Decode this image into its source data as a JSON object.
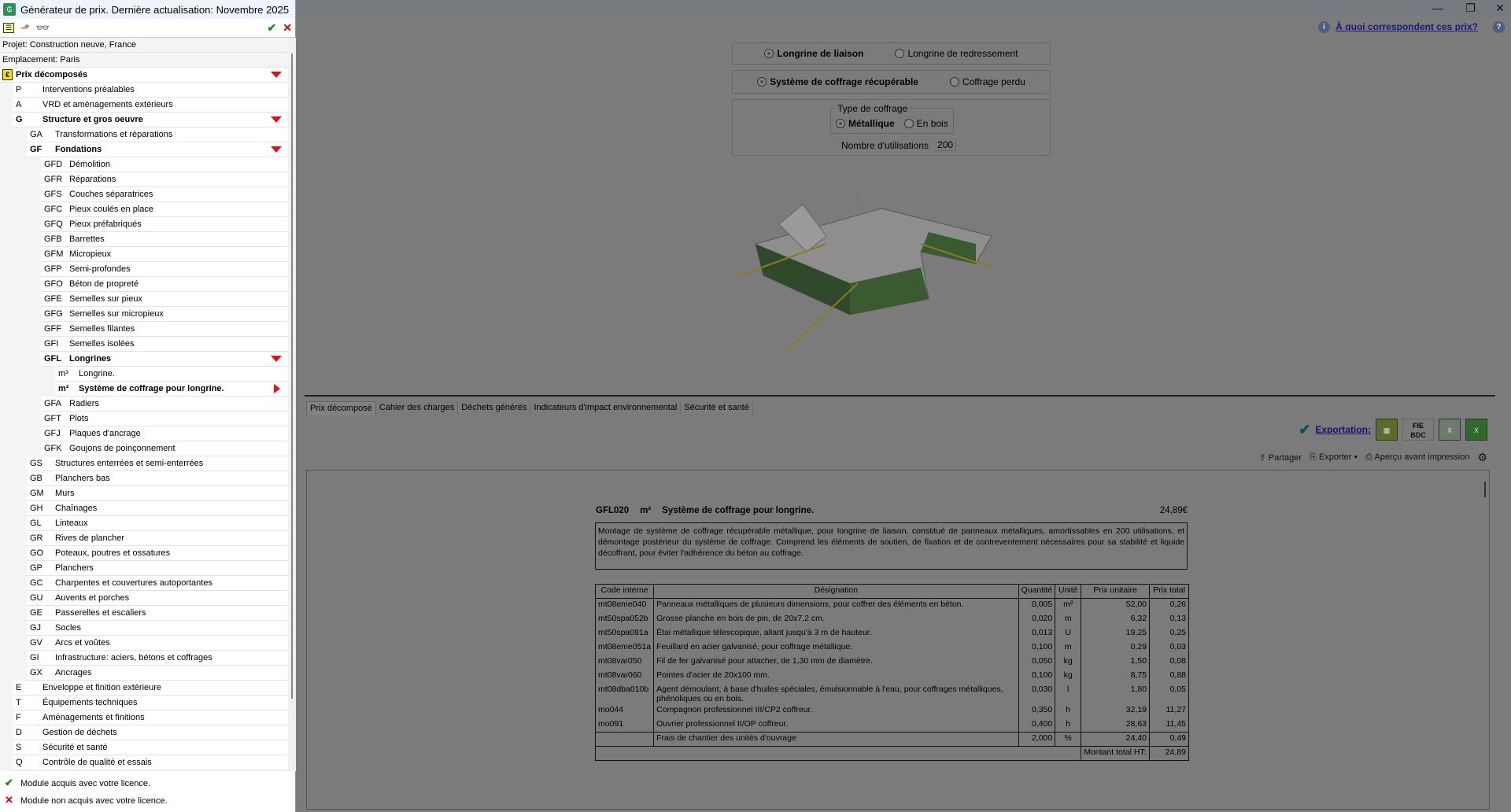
{
  "window": {
    "title": "Générateur de prix. Dernière actualisation: Novembre 2025"
  },
  "left": {
    "project": "Projet: Construction neuve, France",
    "location": "Emplacement: Paris",
    "tree": [
      {
        "code": "",
        "label": "Prix décomposés",
        "level": 0,
        "bold": true,
        "marker": "down"
      },
      {
        "code": "P",
        "label": "Interventions préalables",
        "level": 1
      },
      {
        "code": "A",
        "label": "VRD et aménagements extérieurs",
        "level": 1
      },
      {
        "code": "G",
        "label": "Structure et gros oeuvre",
        "level": 1,
        "bold": true,
        "marker": "down"
      },
      {
        "code": "GA",
        "label": "Transformations et réparations",
        "level": 2
      },
      {
        "code": "GF",
        "label": "Fondations",
        "level": 2,
        "bold": true,
        "marker": "down"
      },
      {
        "code": "GFD",
        "label": "Démolition",
        "level": 3
      },
      {
        "code": "GFR",
        "label": "Réparations",
        "level": 3
      },
      {
        "code": "GFS",
        "label": "Couches séparatrices",
        "level": 3
      },
      {
        "code": "GFC",
        "label": "Pieux coulés en place",
        "level": 3
      },
      {
        "code": "GFQ",
        "label": "Pieux préfabriqués",
        "level": 3
      },
      {
        "code": "GFB",
        "label": "Barrettes",
        "level": 3
      },
      {
        "code": "GFM",
        "label": "Micropieux",
        "level": 3
      },
      {
        "code": "GFP",
        "label": "Semi-profondes",
        "level": 3
      },
      {
        "code": "GFO",
        "label": "Béton de propreté",
        "level": 3
      },
      {
        "code": "GFE",
        "label": "Semelles sur pieux",
        "level": 3
      },
      {
        "code": "GFG",
        "label": "Semelles sur micropieux",
        "level": 3
      },
      {
        "code": "GFF",
        "label": "Semelles filantes",
        "level": 3
      },
      {
        "code": "GFI",
        "label": "Semelles isolées",
        "level": 3
      },
      {
        "code": "GFL",
        "label": "Longrines",
        "level": 3,
        "bold": true,
        "marker": "down"
      },
      {
        "code": "m³",
        "label": "Longrine.",
        "level": 4
      },
      {
        "code": "m²",
        "label": "Système de coffrage pour longrine.",
        "level": 4,
        "bold": true,
        "marker": "right"
      },
      {
        "code": "GFA",
        "label": "Radiers",
        "level": 3
      },
      {
        "code": "GFT",
        "label": "Plots",
        "level": 3
      },
      {
        "code": "GFJ",
        "label": "Plaques d'ancrage",
        "level": 3
      },
      {
        "code": "GFK",
        "label": "Goujons de poinçonnement",
        "level": 3
      },
      {
        "code": "GS",
        "label": "Structures enterrées et semi-enterrées",
        "level": 2
      },
      {
        "code": "GB",
        "label": "Planchers bas",
        "level": 2
      },
      {
        "code": "GM",
        "label": "Murs",
        "level": 2
      },
      {
        "code": "GH",
        "label": "Chaînages",
        "level": 2
      },
      {
        "code": "GL",
        "label": "Linteaux",
        "level": 2
      },
      {
        "code": "GR",
        "label": "Rives de plancher",
        "level": 2
      },
      {
        "code": "GO",
        "label": "Poteaux, poutres et ossatures",
        "level": 2
      },
      {
        "code": "GP",
        "label": "Planchers",
        "level": 2
      },
      {
        "code": "GC",
        "label": "Charpentes et couvertures autoportantes",
        "level": 2
      },
      {
        "code": "GU",
        "label": "Auvents et porches",
        "level": 2
      },
      {
        "code": "GE",
        "label": "Passerelles et escaliers",
        "level": 2
      },
      {
        "code": "GJ",
        "label": "Socles",
        "level": 2
      },
      {
        "code": "GV",
        "label": "Arcs et voûtes",
        "level": 2
      },
      {
        "code": "GI",
        "label": "Infrastructure: aciers, bétons et coffrages",
        "level": 2
      },
      {
        "code": "GX",
        "label": "Ancrages",
        "level": 2
      },
      {
        "code": "E",
        "label": "Enveloppe et finition extérieure",
        "level": 1
      },
      {
        "code": "T",
        "label": "Équipements techniques",
        "level": 1
      },
      {
        "code": "F",
        "label": "Aménagements et finitions",
        "level": 1
      },
      {
        "code": "D",
        "label": "Gestion de déchets",
        "level": 1
      },
      {
        "code": "S",
        "label": "Sécurité et santé",
        "level": 1
      },
      {
        "code": "Q",
        "label": "Contrôle de qualité et essais",
        "level": 1
      }
    ],
    "legend": {
      "acquired": "Module acquis avec votre licence.",
      "not_acquired": "Module non acquis avec votre licence."
    }
  },
  "right": {
    "help_link": "À quoi correspondent ces prix?",
    "options": {
      "type1": "Longrine de liaison",
      "type2": "Longrine de redressement",
      "sys1": "Système de coffrage récupérable",
      "sys2": "Coffrage perdu",
      "group_label": "Type de coffrage",
      "mat1": "Métallique",
      "mat2": "En bois",
      "uses_label": "Nombre d'utilisations",
      "uses_value": "200"
    },
    "tabs": [
      "Prix décomposé",
      "Cahier des charges",
      "Déchets générés",
      "Indicateurs d'impact environnemental",
      "Sécurité et santé"
    ],
    "export_label": "Exportation:",
    "export_icons": [
      "FIE",
      "BDC"
    ],
    "actions": {
      "share": "Partager",
      "export": "Exporter",
      "preview": "Aperçu avant impression"
    },
    "doc": {
      "code": "GFL020",
      "unit": "m²",
      "title": "Système de coffrage pour longrine.",
      "price": "24,89€",
      "description": "Montage de système de coffrage récupérable métallique, pour longrine de liaison, constitué de panneaux métalliques, amortissables en 200 utilisations, et démontage postérieur du système de coffrage. Comprend les éléments de soutien, de fixation et de contreventement nécessaires pour sa stabilité et liquide décoffrant, pour éviter l'adhérence du béton au coffrage.",
      "headers": [
        "Code interne",
        "Désignation",
        "Quantité",
        "Unité",
        "Prix unitaire",
        "Prix total"
      ],
      "rows": [
        [
          "mt08eme040",
          "Panneaux métalliques de plusieurs dimensions, pour coffrer des éléments en béton.",
          "0,005",
          "m²",
          "52,00",
          "0,26"
        ],
        [
          "mt50spa052b",
          "Grosse planche en bois de pin, de 20x7,2 cm.",
          "0,020",
          "m",
          "6,32",
          "0,13"
        ],
        [
          "mt50spa081a",
          "Étai métallique télescopique, allant jusqu'à 3 m de hauteur.",
          "0,013",
          "U",
          "19,25",
          "0,25"
        ],
        [
          "mt08eme051a",
          "Feuillard en acier galvanisé, pour coffrage métallique.",
          "0,100",
          "m",
          "0,29",
          "0,03"
        ],
        [
          "mt08var050",
          "Fil de fer galvanisé pour attacher, de 1,30 mm de diamètre.",
          "0,050",
          "kg",
          "1,50",
          "0,08"
        ],
        [
          "mt08var060",
          "Pointes d'acier de 20x100 mm.",
          "0,100",
          "kg",
          "8,75",
          "0,88"
        ],
        [
          "mt08dba010b",
          "Agent démoulant, à base d'huiles spéciales, émulsionnable à l'eau, pour coffrages métalliques, phénoliques ou en bois.",
          "0,030",
          "l",
          "1,80",
          "0,05"
        ],
        [
          "mo044",
          "Compagnon professionnel III/CP2 coffreur.",
          "0,350",
          "h",
          "32,19",
          "11,27"
        ],
        [
          "mo091",
          "Ouvrier professionnel II/OP coffreur.",
          "0,400",
          "h",
          "28,63",
          "11,45"
        ]
      ],
      "site_costs": [
        "",
        "Frais de chantier des unités d'ouvrage",
        "2,000",
        "%",
        "24,40",
        "0,49"
      ],
      "total_label": "Montant total HT:",
      "total": "24,89"
    }
  }
}
